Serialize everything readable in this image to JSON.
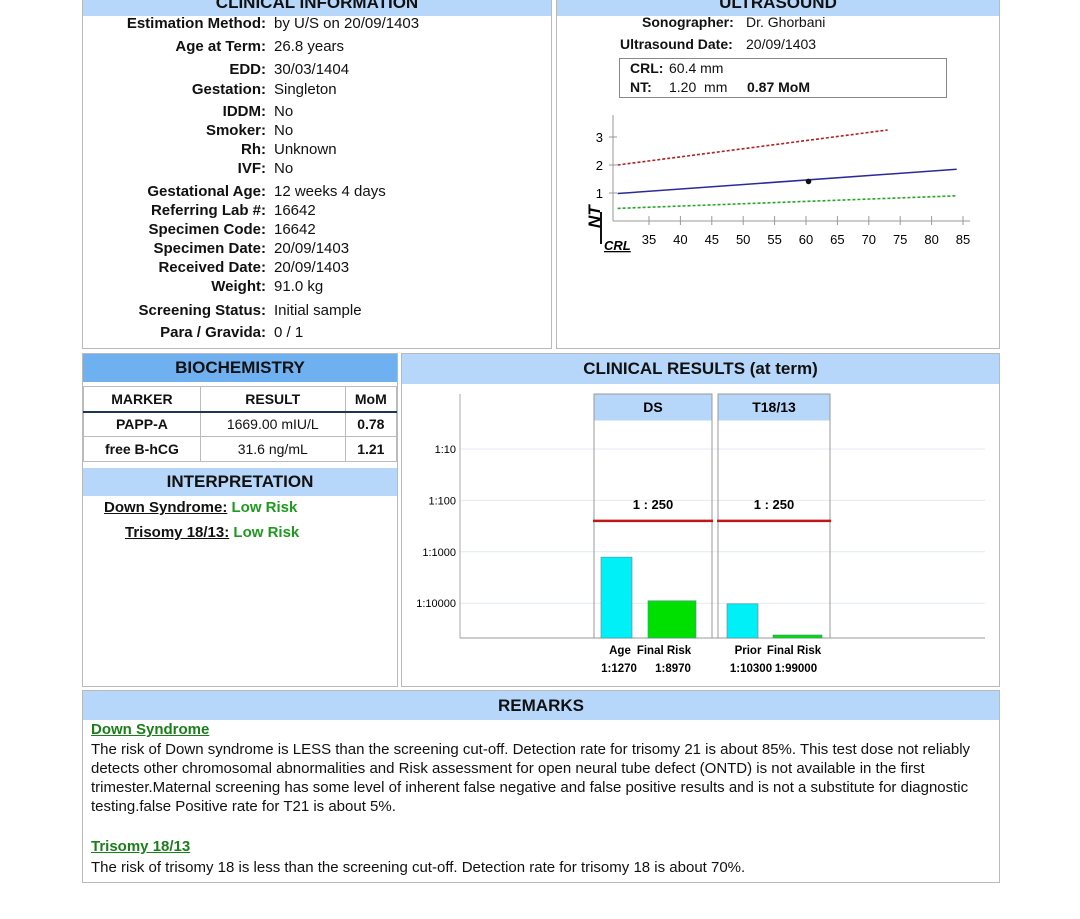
{
  "clinical": {
    "title": "CLINICAL INFORMATION",
    "fields": [
      {
        "label": "Estimation Method:",
        "value": "by U/S on 20/09/1403"
      },
      {
        "label": "Age at Term:",
        "value": "26.8 years"
      },
      {
        "label": "EDD:",
        "value": "30/03/1404"
      },
      {
        "label": "Gestation:",
        "value": "Singleton"
      },
      {
        "label": "IDDM:",
        "value": "No"
      },
      {
        "label": "Smoker:",
        "value": "No"
      },
      {
        "label": "Rh:",
        "value": "Unknown"
      },
      {
        "label": "IVF:",
        "value": "No"
      },
      {
        "label": "Gestational Age:",
        "value": "12 weeks 4 days"
      },
      {
        "label": "Referring Lab #:",
        "value": "16642"
      },
      {
        "label": "Specimen Code:",
        "value": "16642"
      },
      {
        "label": "Specimen Date:",
        "value": "20/09/1403"
      },
      {
        "label": "Received Date:",
        "value": "20/09/1403"
      },
      {
        "label": "Weight:",
        "value": "91.0 kg"
      },
      {
        "label": "Screening Status:",
        "value": "Initial sample"
      },
      {
        "label": "Para / Gravida:",
        "value": "0 / 1"
      }
    ]
  },
  "ultrasound": {
    "title": "ULTRASOUND",
    "sonographer_label": "Sonographer:",
    "sonographer": "Dr. Ghorbani",
    "date_label": "Ultrasound Date:",
    "date": "20/09/1403",
    "crl_label": "CRL:",
    "crl": "60.4 mm",
    "nt_label": "NT:",
    "nt": "1.20  mm",
    "nt_mom": "0.87 MoM"
  },
  "biochemistry": {
    "title": "BIOCHEMISTRY",
    "headers": [
      "MARKER",
      "RESULT",
      "MoM"
    ],
    "rows": [
      {
        "marker": "PAPP-A",
        "result": "1669.00 mIU/L",
        "mom": "0.78"
      },
      {
        "marker": "free B-hCG",
        "result": "31.6 ng/mL",
        "mom": "1.21"
      }
    ]
  },
  "interpretation": {
    "title": "INTERPRETATION",
    "items": [
      {
        "label": "Down Syndrome:",
        "value": "Low Risk"
      },
      {
        "label": "Trisomy 18/13:",
        "value": "Low Risk"
      }
    ],
    "risk_color": "#1f9a1f"
  },
  "results": {
    "title": "CLINICAL RESULTS (at term)"
  },
  "remarks": {
    "title": "REMARKS",
    "sections": [
      {
        "heading": "Down Syndrome",
        "text": "The risk of Down syndrome is LESS than the screening cut-off. Detection rate for trisomy 21 is about 85%. This test dose not reliably detects other chromosomal abnormalities and Risk assessment for open neural tube defect (ONTD) is not available in the first trimester.Maternal screening has some level of inherent false negative and false positive results and is not a substitute for diagnostic testing.false Positive rate for T21 is about 5%."
      },
      {
        "heading": "Trisomy 18/13",
        "text": "The risk of trisomy 18 is less than the screening cut-off. Detection rate for trisomy 18 is about 70%."
      }
    ]
  },
  "chart_data": [
    {
      "type": "line",
      "ylabel": "NT",
      "xlabel": "CRL",
      "xticks": [
        35,
        40,
        45,
        50,
        55,
        60,
        65,
        70,
        75,
        80,
        85
      ],
      "yticks": [
        1,
        2,
        3
      ],
      "xlim": [
        30,
        86
      ],
      "ylim": [
        0,
        3.5
      ],
      "series": [
        {
          "values": [
            [
              30,
              2.0
            ],
            [
              73,
              3.25
            ]
          ],
          "color": "#b22222",
          "style": "dotted"
        },
        {
          "values": [
            [
              30,
              0.98
            ],
            [
              84,
              1.85
            ]
          ],
          "color": "#2a2a9a",
          "style": "solid"
        },
        {
          "values": [
            [
              30,
              0.45
            ],
            [
              84,
              0.9
            ]
          ],
          "color": "#2aa52a",
          "style": "dotted"
        }
      ],
      "point": [
        60.4,
        1.2
      ]
    },
    {
      "type": "bar",
      "scale": "log",
      "yticks": [
        "1:10",
        "1:100",
        "1:1000",
        "1:10000"
      ],
      "groups": [
        {
          "name": "DS",
          "cutoff": "1 : 250",
          "cutoff_value": 250,
          "bars": [
            {
              "label": "Age",
              "value_label": "1:1270",
              "value": 1270,
              "color": "#00f0f8"
            },
            {
              "label": "Final Risk",
              "value_label": "1:8970",
              "value": 8970,
              "color": "#00e000"
            }
          ]
        },
        {
          "name": "T18/13",
          "cutoff": "1 : 250",
          "cutoff_value": 250,
          "bars": [
            {
              "label": "Prior",
              "value_label": "1:10300",
              "value": 10300,
              "color": "#00f0f8"
            },
            {
              "label": "Final Risk",
              "value_label": "1:99000",
              "value": 99000,
              "color": "#00e000"
            }
          ]
        }
      ]
    }
  ]
}
